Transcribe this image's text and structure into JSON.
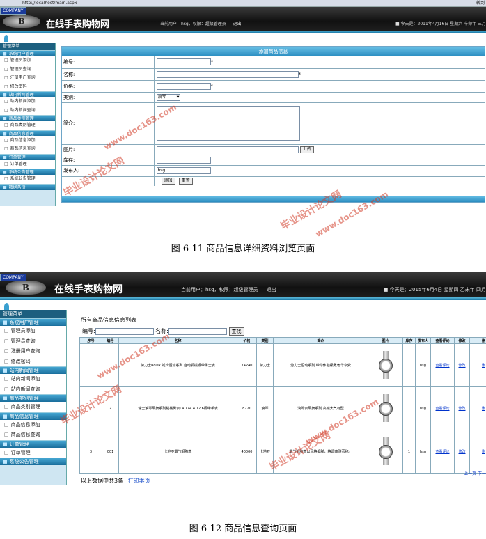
{
  "screenshot1": {
    "address": "http://localhost/main.aspx",
    "go_label": "转到",
    "company": "COMPANY",
    "logo_text": "B",
    "site_title": "在线手表购物网",
    "user_info": "当前用户：hsg，权限：超级管理员",
    "logout": "退出",
    "date_info": "■ 今天是：2011年4月16日 星期六 辛卯年 三月",
    "menu_title": "管理菜单",
    "menu": [
      {
        "group": "系统用户管理",
        "items": [
          "管理员添加",
          "管理员查询",
          "注册用户查询",
          "修改密码"
        ]
      },
      {
        "group": "站内新闻管理",
        "items": [
          "站内新闻添加",
          "站内新闻查询"
        ]
      },
      {
        "group": "商品类别管理",
        "items": [
          "商品类别管理"
        ]
      },
      {
        "group": "商品信息管理",
        "items": [
          "商品信息添加",
          "商品信息查询"
        ]
      },
      {
        "group": "订单管理",
        "items": [
          "订单管理"
        ]
      },
      {
        "group": "系统公告管理",
        "items": [
          "系统公告管理"
        ]
      },
      {
        "group": "数据备份",
        "items": []
      }
    ],
    "form": {
      "title": "添加商品信息",
      "labels": [
        "编号:",
        "名称:",
        "价格:",
        "类别:",
        "简介:",
        "图片:",
        "库存:",
        "发布人:"
      ],
      "required_mark": "*",
      "category_value": "浪琴",
      "upload_btn": "上传",
      "publisher_value": "hsg",
      "add_btn": "添加",
      "reset_btn": "重置"
    }
  },
  "caption1": "图 6-11  商品信息详细资料浏览页面",
  "screenshot2": {
    "company": "COMPANY",
    "logo_text": "B",
    "site_title": "在线手表购物网",
    "user_info": "当前用户：hsg，权限：超级管理员",
    "logout": "退出",
    "date_info": "■ 今天是：2015年6月4日 星期四 乙未年  四月",
    "menu_title": "管理菜单",
    "menu": [
      {
        "group": "系统用户管理",
        "items": [
          "管理员添加",
          "管理员查询",
          "注册用户查询",
          "修改密码"
        ]
      },
      {
        "group": "站内新闻管理",
        "items": [
          "站内新闻添加",
          "站内新闻查询"
        ]
      },
      {
        "group": "商品类别管理",
        "items": [
          "商品类别管理"
        ]
      },
      {
        "group": "商品信息管理",
        "items": [
          "商品信息添加",
          "商品信息查询"
        ]
      },
      {
        "group": "订单管理",
        "items": [
          "订单管理"
        ]
      },
      {
        "group": "系统公告管理",
        "items": []
      }
    ],
    "list_title": "所有商品信息信息列表",
    "search_no_label": "编号:",
    "search_name_label": "名称:",
    "search_btn": "查找",
    "columns": [
      "序号",
      "编号",
      "名称",
      "价格",
      "类别",
      "简介",
      "图片",
      "库存",
      "发布人",
      "查看评论",
      "修改",
      "删"
    ],
    "rows": [
      {
        "seq": "1",
        "code": "",
        "name": "劳力士Rolex 蚝式恒动系列 自动机械钢带男士表",
        "price": "74240",
        "cat": "劳力士",
        "intro": "劳力士恒动系列 带你体验极致奢华享受",
        "stock": "1",
        "pub": "hsg",
        "review": "查看评论",
        "edit": "修改",
        "del": "删"
      },
      {
        "seq": "2",
        "code": "2",
        "name": "瑞士浪琴军旗系列机械男表L4.774.4.12.6钢带手表",
        "price": "8720",
        "cat": "浪琴",
        "intro": "浪琴表军旗系列 高端大气有型",
        "stock": "1",
        "pub": "hsg",
        "review": "查看评论",
        "edit": "修改",
        "del": "删"
      },
      {
        "seq": "3",
        "code": "001",
        "name": "卡地亚霸气钢腕表",
        "price": "40000",
        "cat": "卡地亚",
        "intro": "霸气钢腕表以风格细腻，格调高雅著称。",
        "stock": "1",
        "pub": "hsg",
        "review": "查看评论",
        "edit": "修改",
        "del": "删"
      }
    ],
    "pager": "上一页  下一",
    "footer_text": "以上数据中共3条",
    "print_link": "打印本页"
  },
  "caption2": "图 6-12  商品信息查询页面",
  "watermarks": [
    "毕业设计论文网",
    "www.doc163.com"
  ]
}
